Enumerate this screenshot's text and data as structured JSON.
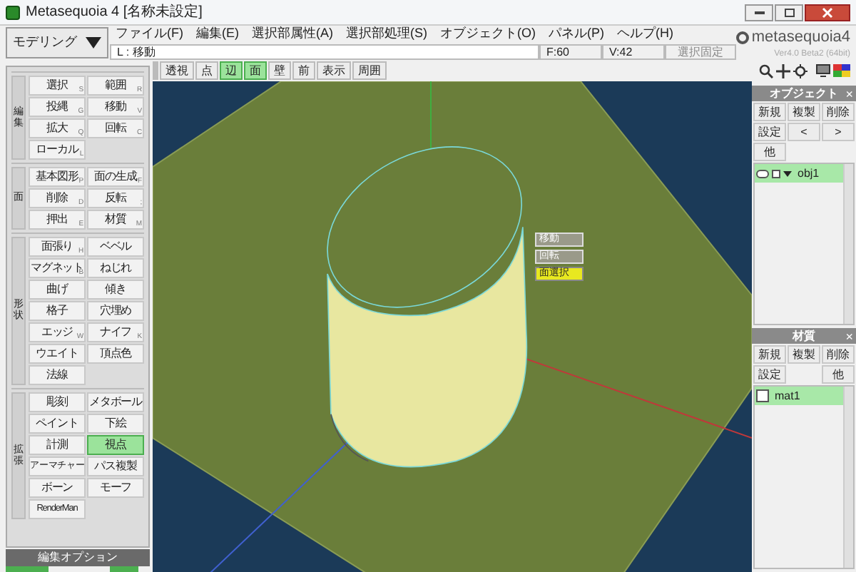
{
  "window": {
    "title": "Metasequoia 4 [名称未設定]"
  },
  "mode_dropdown": {
    "label": "モデリング"
  },
  "menu": [
    "ファイル(F)",
    "編集(E)",
    "選択部属性(A)",
    "選択部処理(S)",
    "オブジェクト(O)",
    "パネル(P)",
    "ヘルプ(H)"
  ],
  "status_bar": {
    "command": "L : 移動",
    "faces": "F:60",
    "vertices": "V:42",
    "lock_button": "選択固定"
  },
  "logo": {
    "name": "metasequoia4",
    "version": "Ver4.0 Beta2 (64bit)"
  },
  "view_toolbar": [
    {
      "label": "透視",
      "selected": false
    },
    {
      "label": "点",
      "selected": false
    },
    {
      "label": "辺",
      "selected": true
    },
    {
      "label": "面",
      "selected": true
    },
    {
      "label": "壁",
      "selected": false
    },
    {
      "label": "前",
      "selected": false
    },
    {
      "label": "表示",
      "selected": false
    },
    {
      "label": "周囲",
      "selected": false
    }
  ],
  "command_groups": [
    {
      "label": "編集",
      "commands": [
        {
          "label": "選択",
          "key": "S",
          "selected": false
        },
        {
          "label": "範囲",
          "key": "R",
          "selected": false
        },
        {
          "label": "投縄",
          "key": "G",
          "selected": false
        },
        {
          "label": "移動",
          "key": "V",
          "selected": false
        },
        {
          "label": "拡大",
          "key": "Q",
          "selected": false
        },
        {
          "label": "回転",
          "key": "C",
          "selected": false
        },
        {
          "label": "ローカル",
          "key": "L",
          "selected": false
        }
      ]
    },
    {
      "label": "面",
      "commands": [
        {
          "label": "基本図形",
          "key": "P",
          "selected": false
        },
        {
          "label": "面の生成",
          "key": "F",
          "selected": false
        },
        {
          "label": "削除",
          "key": "D",
          "selected": false
        },
        {
          "label": "反転",
          "key": ";",
          "selected": false
        },
        {
          "label": "押出",
          "key": "E",
          "selected": false
        },
        {
          "label": "材質",
          "key": "M",
          "selected": false
        }
      ]
    },
    {
      "label": "形状",
      "commands": [
        {
          "label": "面張り",
          "key": "H",
          "selected": false
        },
        {
          "label": "ベベル",
          "selected": false
        },
        {
          "label": "マグネット",
          "key": "B",
          "selected": false
        },
        {
          "label": "ねじれ",
          "selected": false
        },
        {
          "label": "曲げ",
          "selected": false
        },
        {
          "label": "傾き",
          "selected": false
        },
        {
          "label": "格子",
          "selected": false
        },
        {
          "label": "穴埋め",
          "selected": false
        },
        {
          "label": "エッジ",
          "key": "W",
          "selected": false
        },
        {
          "label": "ナイフ",
          "key": "K",
          "selected": false
        },
        {
          "label": "ウエイト",
          "selected": false
        },
        {
          "label": "頂点色",
          "selected": false
        },
        {
          "label": "法線",
          "selected": false
        }
      ]
    },
    {
      "label": "拡張",
      "commands": [
        {
          "label": "彫刻",
          "selected": false
        },
        {
          "label": "メタボール",
          "selected": false
        },
        {
          "label": "ペイント",
          "selected": false
        },
        {
          "label": "下絵",
          "selected": false
        },
        {
          "label": "計測",
          "selected": false
        },
        {
          "label": "視点",
          "selected": true
        },
        {
          "label": "アーマチャー",
          "selected": false
        },
        {
          "label": "パス複製",
          "selected": false
        },
        {
          "label": "ボーン",
          "selected": false
        },
        {
          "label": "モーフ",
          "selected": false
        },
        {
          "label": "RenderMan",
          "selected": false
        }
      ]
    }
  ],
  "edit_options": {
    "label": "編集オプション"
  },
  "context_menu": [
    {
      "label": "移動",
      "selected": false
    },
    {
      "label": "回転",
      "selected": false
    },
    {
      "label": "面選択",
      "selected": true
    }
  ],
  "object_panel": {
    "title": "オブジェクト",
    "close": "×",
    "buttons": [
      "新規",
      "複製",
      "削除",
      "設定",
      "<",
      ">",
      "他"
    ],
    "items": [
      {
        "name": "obj1",
        "selected": true
      }
    ]
  },
  "material_panel": {
    "title": "材質",
    "close": "×",
    "buttons": [
      "新規",
      "複製",
      "削除",
      "設定",
      "他"
    ],
    "items": [
      {
        "name": "mat1",
        "selected": true
      }
    ]
  }
}
